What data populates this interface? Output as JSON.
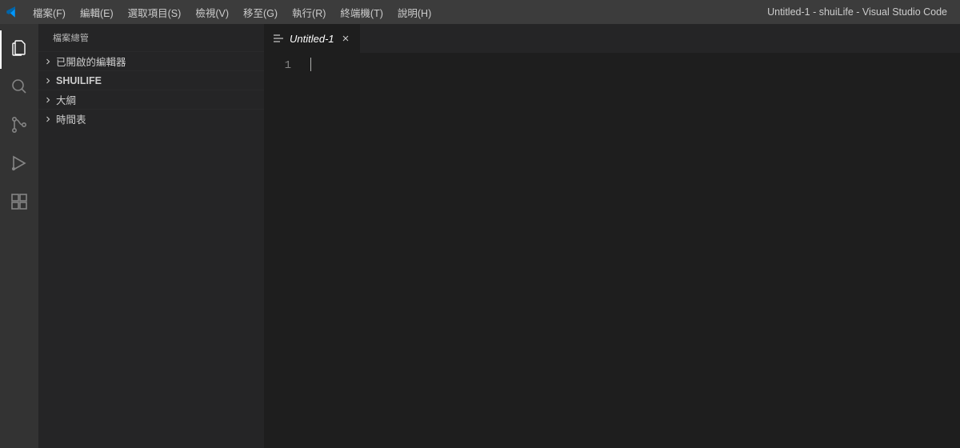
{
  "titlebar": {
    "window_title": "Untitled-1 - shuiLife - Visual Studio Code",
    "menu": [
      "檔案(F)",
      "編輯(E)",
      "選取項目(S)",
      "檢視(V)",
      "移至(G)",
      "執行(R)",
      "終端機(T)",
      "說明(H)"
    ]
  },
  "activitybar": {
    "items": [
      {
        "name": "explorer",
        "active": true
      },
      {
        "name": "search",
        "active": false
      },
      {
        "name": "source-control",
        "active": false
      },
      {
        "name": "run-debug",
        "active": false
      },
      {
        "name": "extensions",
        "active": false
      }
    ]
  },
  "sidebar": {
    "title": "檔案總管",
    "sections": [
      {
        "label": "已開啟的編輯器",
        "bold": false
      },
      {
        "label": "SHUILIFE",
        "bold": true
      },
      {
        "label": "大綱",
        "bold": false
      },
      {
        "label": "時間表",
        "bold": false
      }
    ]
  },
  "editor": {
    "tab_label": "Untitled-1",
    "line_number": "1"
  }
}
